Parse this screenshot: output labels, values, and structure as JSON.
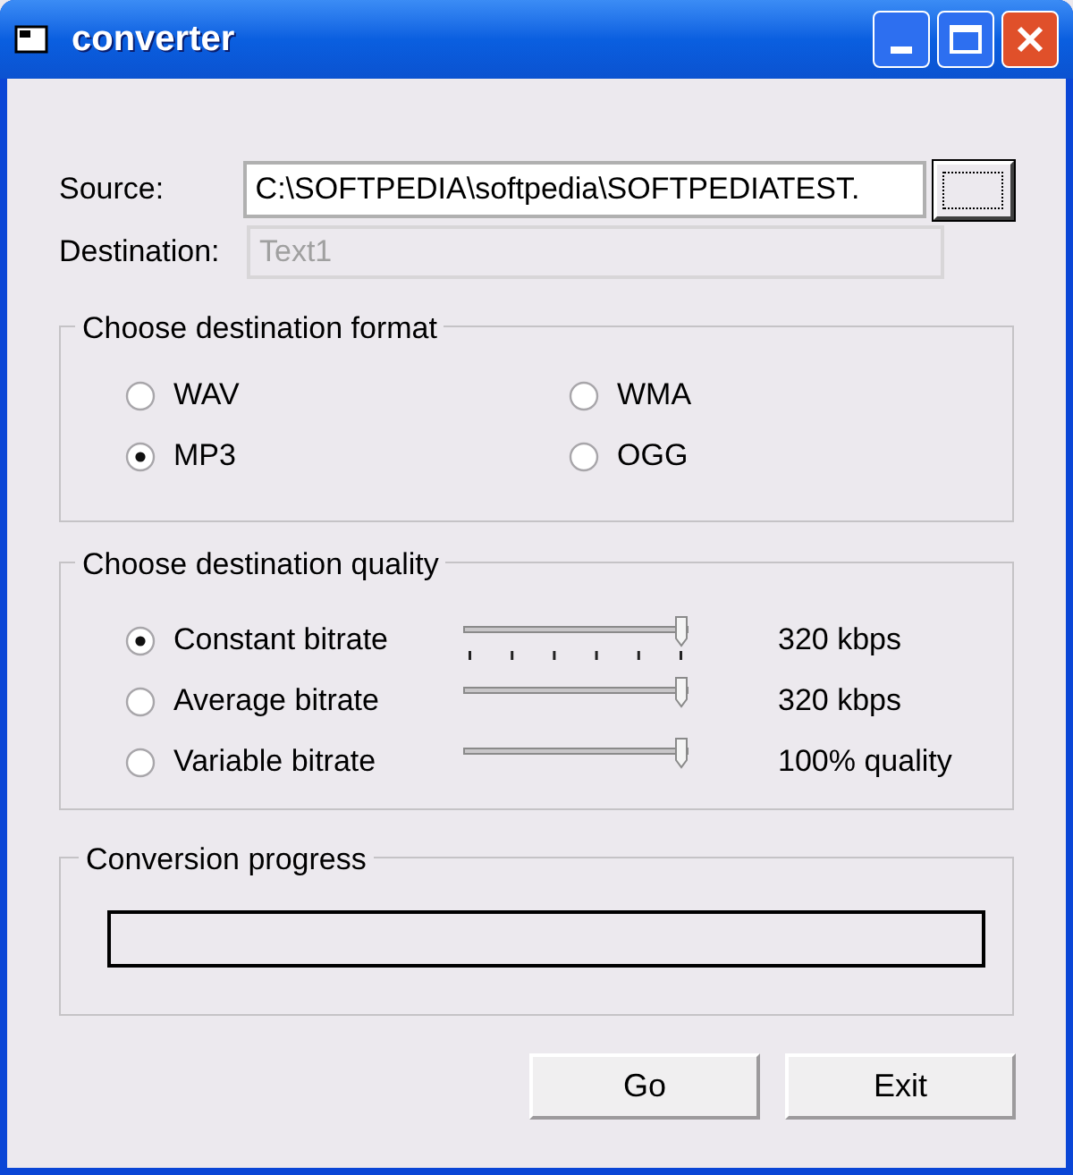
{
  "window": {
    "title": "converter"
  },
  "source": {
    "label": "Source:",
    "value": "C:\\SOFTPEDIA\\softpedia\\SOFTPEDIATEST."
  },
  "destination": {
    "label": "Destination:",
    "value": "Text1",
    "disabled": true
  },
  "format_group": {
    "title": "Choose destination format",
    "options": [
      {
        "label": "WAV",
        "selected": false
      },
      {
        "label": "WMA",
        "selected": false
      },
      {
        "label": "MP3",
        "selected": true
      },
      {
        "label": "OGG",
        "selected": false
      }
    ]
  },
  "quality_group": {
    "title": "Choose destination quality",
    "options": [
      {
        "label": "Constant bitrate",
        "selected": true,
        "level": 1,
        "ticks": true,
        "reading": "320 kbps"
      },
      {
        "label": "Average bitrate",
        "selected": false,
        "level": 1,
        "ticks": false,
        "reading": "320 kbps"
      },
      {
        "label": "Variable bitrate",
        "selected": false,
        "level": 1,
        "ticks": false,
        "reading": "100% quality"
      }
    ]
  },
  "progress_group": {
    "title": "Conversion progress",
    "level": 0
  },
  "buttons": [
    "Go",
    "Exit"
  ]
}
